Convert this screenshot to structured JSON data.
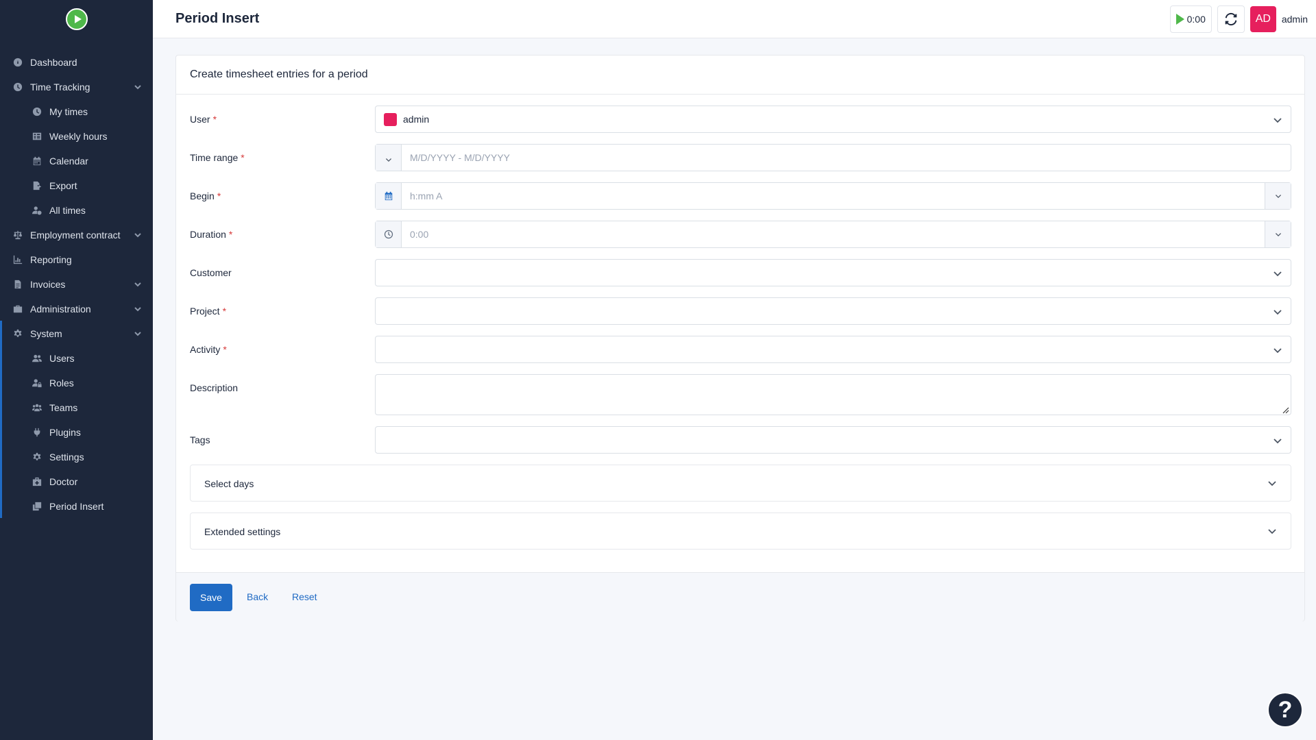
{
  "app": {
    "title": "Period Insert"
  },
  "sidebar": {
    "items": [
      {
        "label": "Dashboard",
        "icon": "dashboard-icon"
      },
      {
        "label": "Time Tracking",
        "icon": "clock-icon"
      },
      {
        "label": "My times",
        "icon": "clock-icon"
      },
      {
        "label": "Weekly hours",
        "icon": "grid-icon"
      },
      {
        "label": "Calendar",
        "icon": "calendar-icon"
      },
      {
        "label": "Export",
        "icon": "export-icon"
      },
      {
        "label": "All times",
        "icon": "user-clock-icon"
      },
      {
        "label": "Employment contract",
        "icon": "scale-icon"
      },
      {
        "label": "Reporting",
        "icon": "chart-icon"
      },
      {
        "label": "Invoices",
        "icon": "file-icon"
      },
      {
        "label": "Administration",
        "icon": "briefcase-icon"
      },
      {
        "label": "System",
        "icon": "gear-icon"
      },
      {
        "label": "Users",
        "icon": "users-icon"
      },
      {
        "label": "Roles",
        "icon": "user-lock-icon"
      },
      {
        "label": "Teams",
        "icon": "team-icon"
      },
      {
        "label": "Plugins",
        "icon": "plug-icon"
      },
      {
        "label": "Settings",
        "icon": "gear-icon"
      },
      {
        "label": "Doctor",
        "icon": "medkit-icon"
      },
      {
        "label": "Period Insert",
        "icon": "copy-icon"
      }
    ]
  },
  "header": {
    "timer": "0:00",
    "avatar_initials": "AD",
    "username": "admin",
    "avatar_color": "#e61f5d",
    "accent_color": "#206bc4"
  },
  "form": {
    "card_title": "Create timesheet entries for a period",
    "required_mark": "*",
    "user": {
      "label": "User",
      "value": "admin",
      "color": "#e61f5d"
    },
    "time_range": {
      "label": "Time range",
      "placeholder": "M/D/YYYY - M/D/YYYY"
    },
    "begin": {
      "label": "Begin",
      "placeholder": "h:mm A"
    },
    "duration": {
      "label": "Duration",
      "placeholder": "0:00"
    },
    "customer": {
      "label": "Customer"
    },
    "project": {
      "label": "Project"
    },
    "activity": {
      "label": "Activity"
    },
    "description": {
      "label": "Description"
    },
    "tags": {
      "label": "Tags"
    },
    "select_days": "Select days",
    "extended_settings": "Extended settings"
  },
  "footer": {
    "save": "Save",
    "back": "Back",
    "reset": "Reset"
  },
  "help": {
    "label": "?"
  }
}
